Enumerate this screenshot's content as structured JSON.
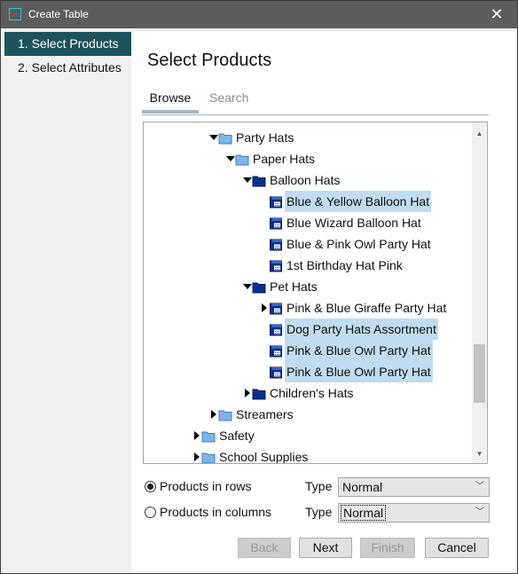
{
  "window": {
    "title": "Create Table",
    "close_glyph": "✕"
  },
  "nav": {
    "items": [
      {
        "label": "1. Select Products",
        "active": true
      },
      {
        "label": "2. Select Attributes",
        "active": false
      }
    ]
  },
  "main": {
    "heading": "Select Products",
    "tabs": [
      {
        "label": "Browse",
        "active": true
      },
      {
        "label": "Search",
        "active": false
      }
    ],
    "tree": [
      {
        "label": "Party Hats",
        "depth": 0,
        "expander": "expanded",
        "icon": "folder-open-icon",
        "selected": false
      },
      {
        "label": "Paper Hats",
        "depth": 1,
        "expander": "expanded",
        "icon": "folder-open-icon",
        "selected": false
      },
      {
        "label": "Balloon Hats",
        "depth": 2,
        "expander": "expanded",
        "icon": "folder-blue-icon",
        "selected": false
      },
      {
        "label": "Blue & Yellow Balloon Hat",
        "depth": 3,
        "expander": "none",
        "icon": "product-icon",
        "selected": true
      },
      {
        "label": "Blue Wizard Balloon Hat",
        "depth": 3,
        "expander": "none",
        "icon": "product-icon",
        "selected": false
      },
      {
        "label": "Blue & Pink Owl Party Hat",
        "depth": 3,
        "expander": "none",
        "icon": "product-icon",
        "selected": false
      },
      {
        "label": "1st Birthday Hat Pink",
        "depth": 3,
        "expander": "none",
        "icon": "product-icon",
        "selected": false
      },
      {
        "label": "Pet Hats",
        "depth": 2,
        "expander": "expanded",
        "icon": "folder-blue-icon",
        "selected": false
      },
      {
        "label": "Pink & Blue Giraffe Party Hat",
        "depth": 3,
        "expander": "collapsed",
        "icon": "product-icon",
        "selected": false
      },
      {
        "label": "Dog Party Hats Assortment",
        "depth": 3,
        "expander": "none",
        "icon": "product-icon",
        "selected": true
      },
      {
        "label": "Pink & Blue Owl Party Hat",
        "depth": 3,
        "expander": "none",
        "icon": "product-icon",
        "selected": true
      },
      {
        "label": "Pink & Blue Owl Party Hat",
        "depth": 3,
        "expander": "none",
        "icon": "product-icon",
        "selected": true
      },
      {
        "label": "Children's Hats",
        "depth": 2,
        "expander": "collapsed",
        "icon": "folder-blue-icon",
        "selected": false
      },
      {
        "label": "Streamers",
        "depth": 0,
        "expander": "collapsed",
        "icon": "folder-open-icon",
        "selected": false
      },
      {
        "label": "Safety",
        "depth": -1,
        "expander": "collapsed",
        "icon": "folder-open-icon",
        "selected": false
      },
      {
        "label": "School Supplies",
        "depth": -1,
        "expander": "collapsed",
        "icon": "folder-open-icon",
        "selected": false
      }
    ],
    "options": [
      {
        "label": "Products in rows",
        "checked": true,
        "type_label": "Type",
        "type_value": "Normal"
      },
      {
        "label": "Products in columns",
        "checked": false,
        "type_label": "Type",
        "type_value": "Normal"
      }
    ]
  },
  "buttons": {
    "back": "Back",
    "next": "Next",
    "finish": "Finish",
    "cancel": "Cancel"
  },
  "colors": {
    "nav_active": "#1c535b",
    "selection": "#c1dcf0",
    "folder_light": "#7fb4e6",
    "folder_dark": "#0b2f8f",
    "titlebar": "#5c5c5c"
  }
}
